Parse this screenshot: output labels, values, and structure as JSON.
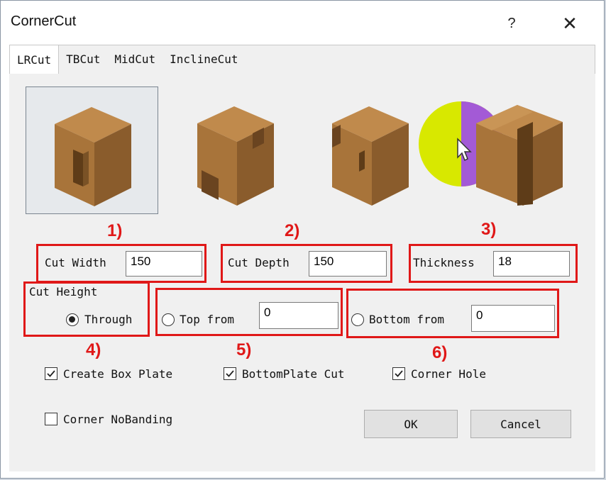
{
  "window": {
    "title": "CornerCut",
    "help": "?",
    "close": "✕"
  },
  "tabs": [
    {
      "label": "LRCut",
      "active": true
    },
    {
      "label": "TBCut"
    },
    {
      "label": "MidCut"
    },
    {
      "label": "InclineCut"
    }
  ],
  "annotations": [
    "1)",
    "2)",
    "3)",
    "4)",
    "5)",
    "6)"
  ],
  "fields": {
    "cut_width": {
      "label": "Cut Width",
      "value": "150"
    },
    "cut_depth": {
      "label": "Cut Depth",
      "value": "150"
    },
    "thickness": {
      "label": "Thickness",
      "value": "18"
    }
  },
  "cut_height": {
    "label": "Cut Height",
    "through_label": "Through",
    "top_from_label": "Top from",
    "top_from_value": "0",
    "bottom_from_label": "Bottom from",
    "bottom_from_value": "0",
    "selected": "Through"
  },
  "checkboxes": {
    "create_box_plate": {
      "label": "Create Box Plate",
      "checked": true
    },
    "bottomplate_cut": {
      "label": "BottomPlate Cut",
      "checked": true
    },
    "corner_hole": {
      "label": "Corner Hole",
      "checked": true
    },
    "corner_nobanding": {
      "label": "Corner NoBanding",
      "checked": false
    }
  },
  "buttons": {
    "ok": "OK",
    "cancel": "Cancel"
  },
  "colors": {
    "wood": "#b07a3e",
    "wood_dark": "#7e5327",
    "annotation_red": "#e01818",
    "highlight_yellow": "#d8e800",
    "highlight_purple": "#a35ad6"
  }
}
